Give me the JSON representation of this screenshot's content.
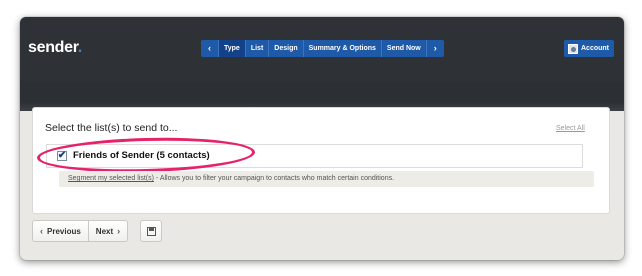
{
  "app": {
    "logo_text": "sender",
    "logo_dot": "."
  },
  "stepnav": {
    "prev_icon": "chevron-left-icon",
    "next_icon": "chevron-right-icon",
    "steps": [
      "Type",
      "List",
      "Design",
      "Summary & Options",
      "Send Now"
    ],
    "active_step": "Type"
  },
  "account": {
    "label": "Account",
    "icon": "avatar-icon"
  },
  "main": {
    "title": "Select the list(s) to send to...",
    "select_all": "Select All",
    "lists": [
      {
        "label": "Friends of Sender (5 contacts)",
        "checked": true
      }
    ],
    "segment_link": "Segment my selected list(s)",
    "segment_text": " - Allows you to filter your campaign to contacts who match certain conditions."
  },
  "footer": {
    "previous_label": "Previous",
    "next_label": "Next",
    "save_icon": "floppy-disk-icon"
  },
  "colors": {
    "nav_blue": "#1e5aa8",
    "header_dark": "#2e3136",
    "highlight_pink": "#e5236c"
  }
}
